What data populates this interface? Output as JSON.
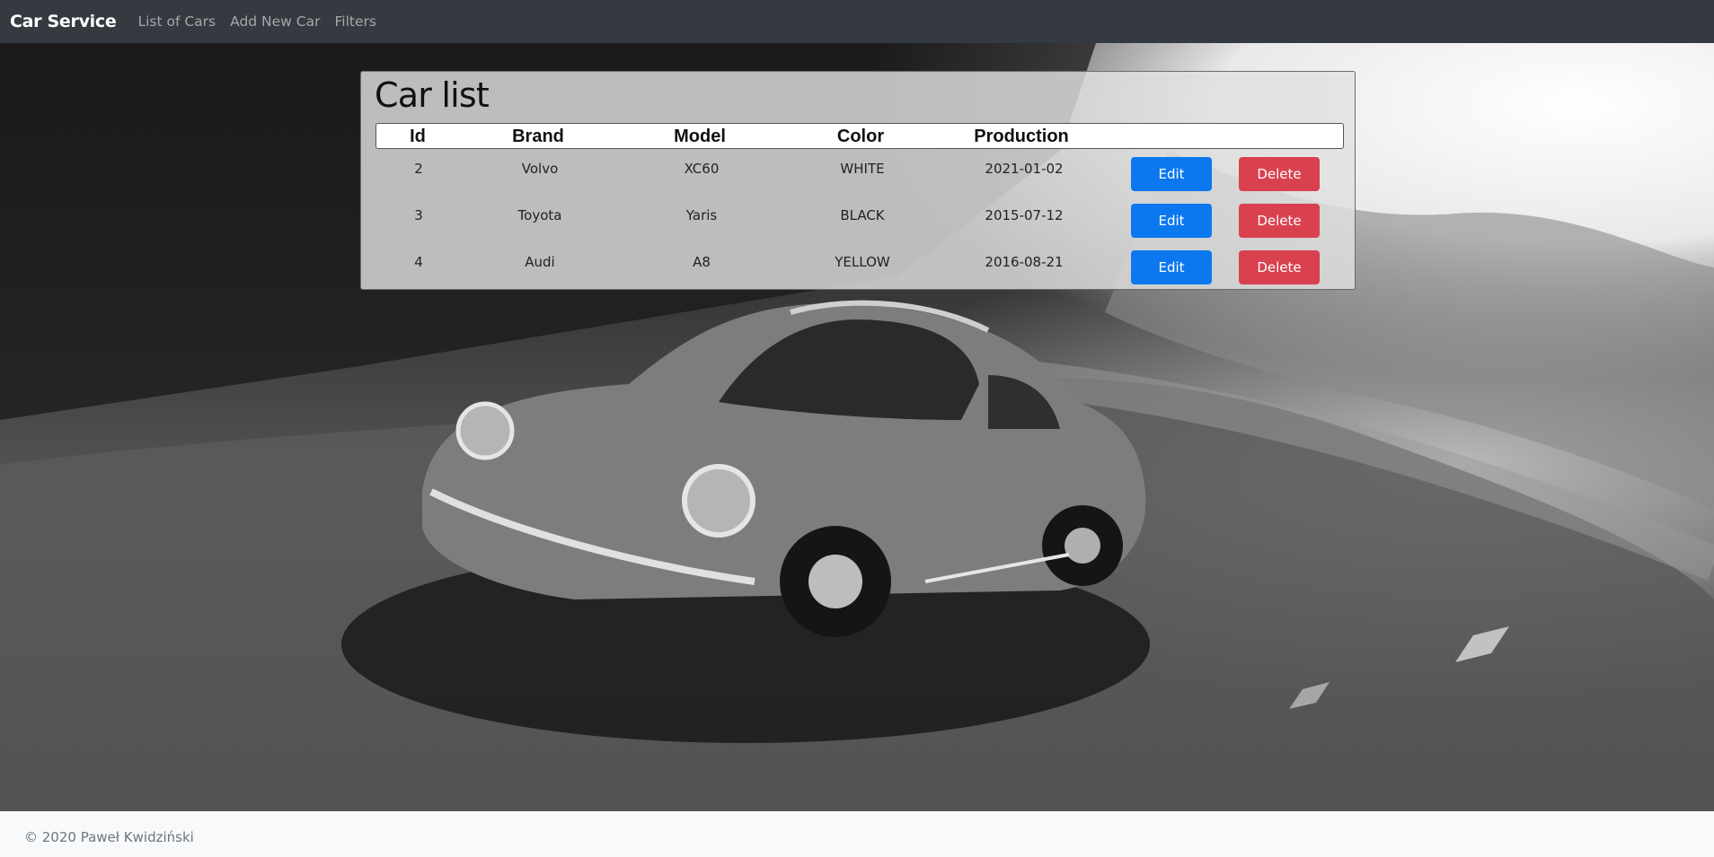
{
  "navbar": {
    "brand": "Car Service",
    "links": [
      "List of Cars",
      "Add New Car",
      "Filters"
    ]
  },
  "card": {
    "title": "Car list",
    "headers": [
      "Id",
      "Brand",
      "Model",
      "Color",
      "Production"
    ],
    "rows": [
      {
        "id": "2",
        "brand": "Volvo",
        "model": "XC60",
        "color": "WHITE",
        "production": "2021-01-02",
        "edit": "Edit",
        "delete": "Delete"
      },
      {
        "id": "3",
        "brand": "Toyota",
        "model": "Yaris",
        "color": "BLACK",
        "production": "2015-07-12",
        "edit": "Edit",
        "delete": "Delete"
      },
      {
        "id": "4",
        "brand": "Audi",
        "model": "A8",
        "color": "YELLOW",
        "production": "2016-08-21",
        "edit": "Edit",
        "delete": "Delete"
      }
    ]
  },
  "footer": {
    "text": "© 2020 Paweł Kwidziński"
  },
  "colors": {
    "navbar": "#343a40",
    "edit_button": "#0b78f0",
    "delete_button": "#d9414f"
  }
}
